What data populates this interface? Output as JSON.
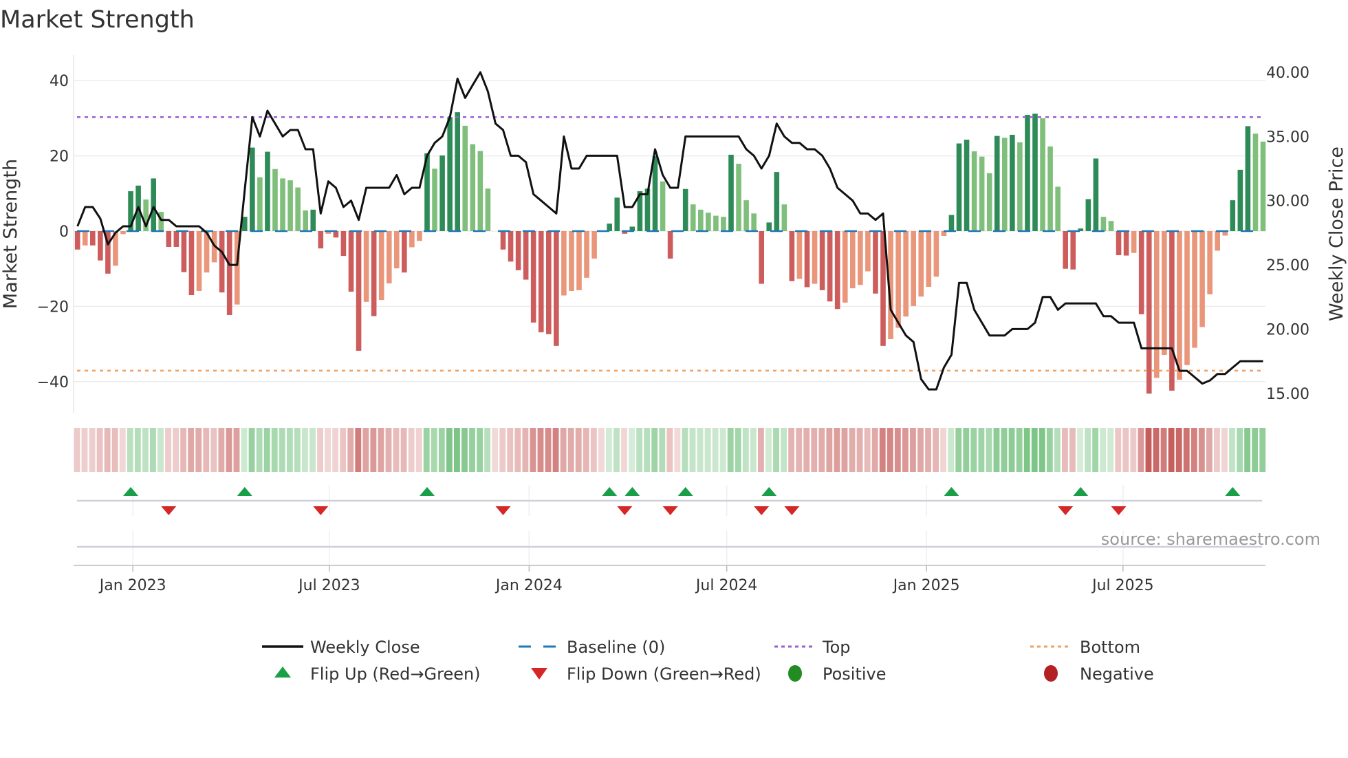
{
  "title": "Market Strength",
  "source": "source: sharemaestro.com",
  "colors": {
    "pos_dark": "#2e8b57",
    "pos_light": "#7fbf7b",
    "neg_dark": "#cd5c5c",
    "neg_light": "#e9967a",
    "close": "#111111",
    "baseline": "#1f77b4",
    "top": "#9b5fd6",
    "bottom": "#f0a060",
    "flip_up": "#1a9e48",
    "flip_down": "#d62728",
    "positive": "#228b22",
    "negative": "#b22222"
  },
  "chart_data": {
    "type": "bar",
    "title": "Market Strength",
    "ylabel": "Market Strength",
    "y2label": "Weekly Close Price",
    "ylim": [
      -48,
      46
    ],
    "y2lim": [
      13.5,
      41
    ],
    "yticks": [
      40,
      20,
      0,
      -20,
      -40
    ],
    "ytick_labels": [
      "40",
      "20",
      "0",
      "−20",
      "−40"
    ],
    "y2ticks": [
      40,
      35,
      30,
      25,
      20,
      15
    ],
    "y2tick_labels": [
      "40.00",
      "35.00",
      "30.00",
      "25.00",
      "20.00",
      "15.00"
    ],
    "x_start": "2022-11-11",
    "x_step_days": 7,
    "xticks": [
      {
        "date": "2023-01-01",
        "label": "Jan 2023"
      },
      {
        "date": "2023-07-01",
        "label": "Jul 2023"
      },
      {
        "date": "2024-01-01",
        "label": "Jan 2024"
      },
      {
        "date": "2024-07-01",
        "label": "Jul 2024"
      },
      {
        "date": "2025-01-01",
        "label": "Jan 2025"
      },
      {
        "date": "2025-07-01",
        "label": "Jul 2025"
      }
    ],
    "top_level": 30.3,
    "bottom_level": -37.1,
    "baseline": 0,
    "strength": [
      -4.9,
      -3.8,
      -3.8,
      -7.8,
      -11.3,
      -9.2,
      -0.8,
      10.6,
      12.1,
      8.4,
      14.0,
      5.1,
      -4.2,
      -4.2,
      -10.9,
      -17.0,
      -15.9,
      -11.0,
      -8.3,
      -16.3,
      -22.3,
      -19.5,
      3.8,
      22.2,
      14.3,
      21.1,
      16.5,
      14.0,
      13.5,
      11.6,
      5.5,
      5.7,
      -4.6,
      -0.7,
      -1.7,
      -6.6,
      -16.1,
      -31.8,
      -18.8,
      -22.6,
      -18.3,
      -13.9,
      -9.9,
      -11.0,
      -4.3,
      -2.6,
      20.7,
      16.6,
      20.1,
      30.3,
      31.6,
      28.0,
      23.1,
      21.3,
      11.3,
      0,
      -4.9,
      -8.1,
      -10.4,
      -12.9,
      -24.3,
      -26.9,
      -27.4,
      -30.5,
      -17.1,
      -15.9,
      -15.7,
      -12.4,
      -7.3,
      0,
      2.0,
      8.9,
      -0.7,
      1.2,
      10.6,
      11.3,
      19.9,
      13.2,
      -7.3,
      0,
      11.2,
      7.1,
      5.7,
      4.9,
      4.1,
      3.8,
      20.3,
      17.9,
      8.2,
      4.7,
      -14.0,
      2.3,
      15.7,
      7.1,
      -13.3,
      -12.7,
      -14.9,
      -14.0,
      -15.7,
      -18.7,
      -20.7,
      -19.0,
      -15.2,
      -14.3,
      -10.7,
      -16.6,
      -30.5,
      -28.7,
      -25.7,
      -22.7,
      -19.9,
      -17.4,
      -14.8,
      -12.1,
      -1.3,
      4.3,
      23.3,
      24.3,
      21.2,
      19.8,
      15.4,
      25.3,
      24.8,
      25.6,
      23.6,
      30.9,
      31.2,
      30.0,
      22.5,
      11.8,
      -10.0,
      -10.2,
      0.7,
      8.5,
      19.3,
      3.8,
      2.7,
      -6.4,
      -6.5,
      -5.8,
      -22.1,
      -43.2,
      -39.0,
      -32.9,
      -42.4,
      -39.5,
      -35.6,
      -31.0,
      -25.5,
      -16.8,
      -5.2,
      -1.2,
      8.2,
      16.3,
      27.9,
      25.9,
      23.8
    ],
    "weekly_close": [
      28.0,
      29.5,
      29.5,
      28.6,
      26.6,
      27.5,
      28.0,
      28.0,
      29.5,
      28.0,
      29.5,
      28.5,
      28.5,
      28.0,
      28.0,
      28.0,
      28.0,
      27.5,
      26.5,
      26.0,
      25.0,
      25.0,
      30.8,
      36.5,
      35.0,
      37.0,
      36.0,
      35.0,
      35.5,
      35.5,
      34.0,
      34.0,
      29.0,
      31.5,
      31.0,
      29.5,
      30.0,
      28.5,
      31.0,
      31.0,
      31.0,
      31.0,
      32.0,
      30.5,
      31.0,
      31.0,
      33.5,
      34.5,
      35.0,
      36.5,
      39.5,
      38.0,
      39.0,
      40.0,
      38.5,
      36.0,
      35.5,
      33.5,
      33.5,
      33.0,
      30.5,
      30.0,
      29.5,
      29.0,
      35.0,
      32.5,
      32.5,
      33.5,
      33.5,
      33.5,
      33.5,
      33.5,
      29.5,
      29.5,
      30.5,
      30.5,
      34.0,
      32.0,
      31.0,
      31.0,
      35.0,
      35.0,
      35.0,
      35.0,
      35.0,
      35.0,
      35.0,
      35.0,
      34.0,
      33.5,
      32.5,
      33.5,
      36.0,
      35.0,
      34.5,
      34.5,
      34.0,
      34.0,
      33.5,
      32.5,
      31.0,
      30.5,
      30.0,
      29.0,
      29.0,
      28.5,
      29.0,
      21.5,
      20.5,
      19.5,
      19.0,
      16.1,
      15.3,
      15.3,
      17.0,
      18.0,
      23.6,
      23.6,
      21.5,
      20.5,
      19.5,
      19.5,
      19.5,
      20.0,
      20.0,
      20.0,
      20.5,
      22.5,
      22.5,
      21.5,
      22.0,
      22.0,
      22.0,
      22.0,
      22.0,
      21.0,
      21.0,
      20.5,
      20.5,
      20.5,
      18.5,
      18.5,
      18.5,
      18.5,
      18.5,
      16.75,
      16.75,
      16.25,
      15.75,
      16.0,
      16.5,
      16.5,
      17.0,
      17.5,
      17.5,
      17.5,
      17.5
    ],
    "legend": {
      "placement": "bottom",
      "items": [
        {
          "label": "Weekly Close",
          "symbol": "line"
        },
        {
          "label": "Baseline (0)",
          "symbol": "dash"
        },
        {
          "label": "Top",
          "symbol": "dot-line-top"
        },
        {
          "label": "Bottom",
          "symbol": "dot-line-bottom"
        },
        {
          "label": "Flip Up (Red→Green)",
          "symbol": "triangle-up"
        },
        {
          "label": "Flip Down (Green→Red)",
          "symbol": "triangle-down"
        },
        {
          "label": "Positive",
          "symbol": "circle-positive"
        },
        {
          "label": "Negative",
          "symbol": "circle-negative"
        }
      ]
    }
  }
}
